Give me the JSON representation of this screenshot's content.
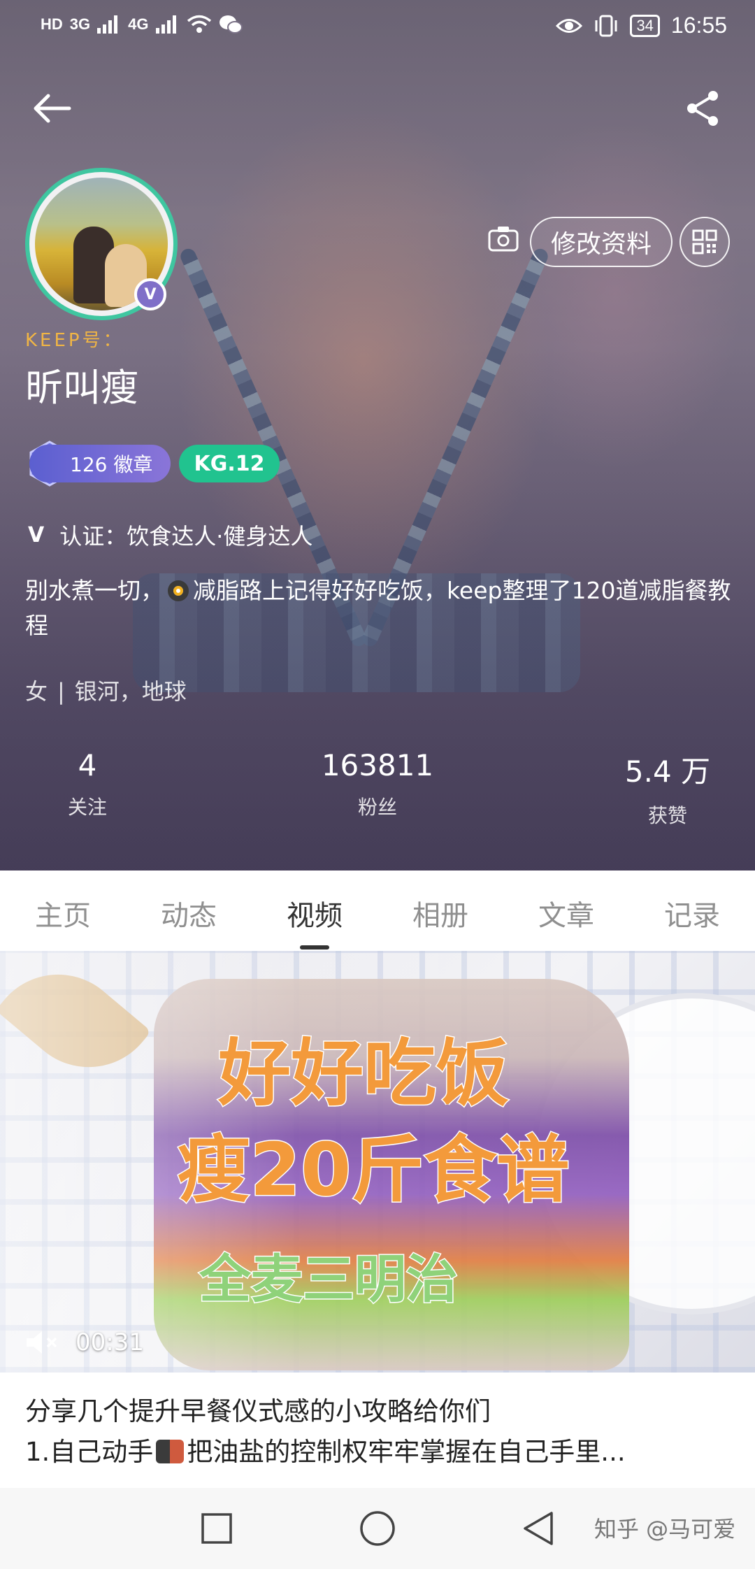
{
  "status_bar": {
    "left": "HD",
    "network_1": "3G",
    "network_2": "4G",
    "battery": "34",
    "time": "16:55"
  },
  "header": {
    "back_icon": "arrow-left-icon",
    "share_icon": "share-icon"
  },
  "profile": {
    "keep_label": "KEEP号：",
    "username": "昕叫瘦",
    "verified_badge": "V",
    "edit_button": "修改资料",
    "medal_count": "126 徽章",
    "level": "KG.12",
    "cert_icon": "V",
    "certification": "认证：饮食达人·健身达人",
    "bio_part1": "别水煮一切，",
    "bio_part2": "减脂路上记得好好吃饭，keep整理了120道减脂餐教程",
    "gender": "女",
    "separator": "|",
    "location": "银河，地球"
  },
  "stats": [
    {
      "value": "4",
      "label": "关注"
    },
    {
      "value": "163811",
      "label": "粉丝"
    },
    {
      "value": "5.4 万",
      "label": "获赞"
    }
  ],
  "tabs": [
    {
      "label": "主页"
    },
    {
      "label": "动态"
    },
    {
      "label": "视频",
      "active": true
    },
    {
      "label": "相册"
    },
    {
      "label": "文章"
    },
    {
      "label": "记录"
    }
  ],
  "video": {
    "title_line1": "好好吃饭",
    "title_line2": "瘦20斤食谱",
    "title_line3": "全麦三明治",
    "duration": "00:31",
    "mute_icon": "speaker-muted-icon"
  },
  "post": {
    "line1": "分享几个提升早餐仪式感的小攻略给你们",
    "line2_prefix": "1.自己动手",
    "line2_suffix": "把油盐的控制权牢牢掌握在自己手里..."
  },
  "navbar": {
    "watermark": "知乎 @马可爱"
  },
  "colors": {
    "accent_green": "#21c38f",
    "medal_purple": "#6f69d6",
    "keep_gold": "#f0b545",
    "video_title_orange": "#f39a3b",
    "video_subtitle_green": "#8fd27a"
  }
}
